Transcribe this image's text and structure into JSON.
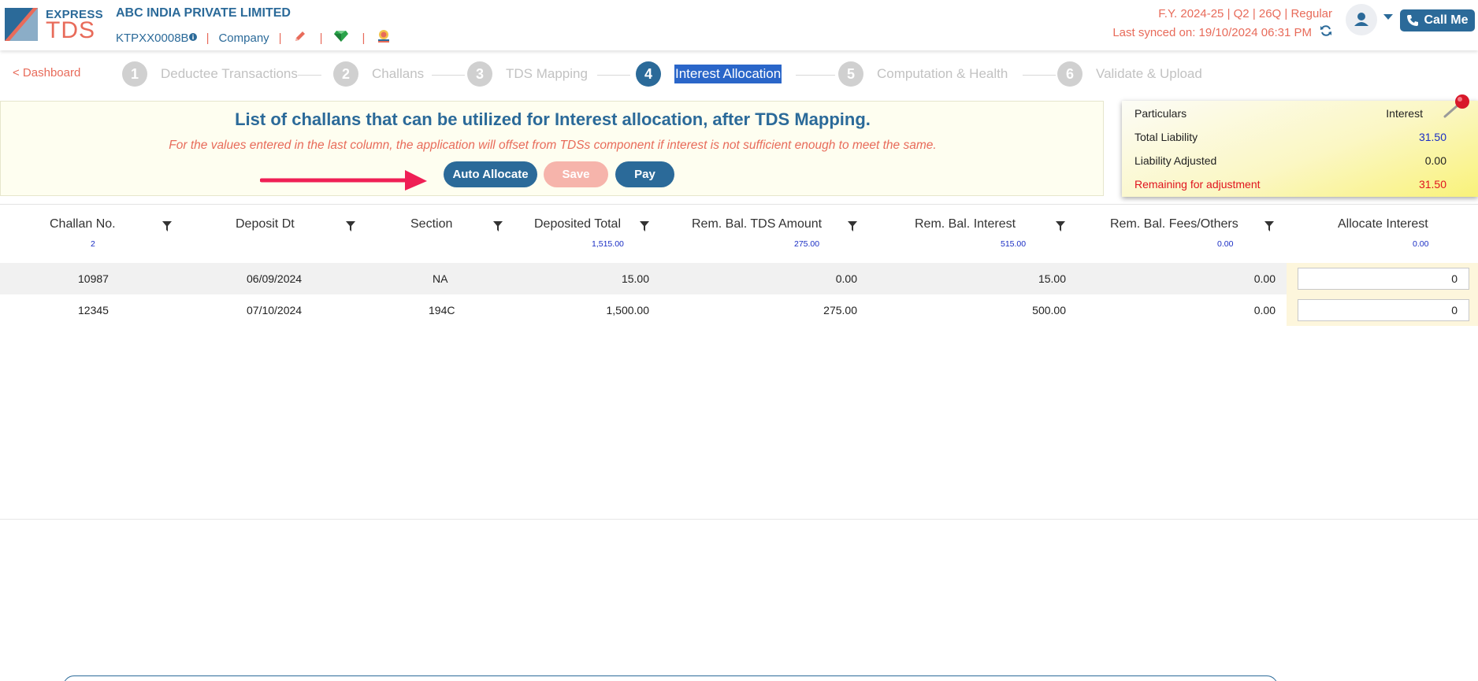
{
  "header": {
    "logo_top": "EXPRESS",
    "logo_bottom": "TDS",
    "company_name": "ABC INDIA PRIVATE LIMITED",
    "tan": "KTPXX0008B",
    "tan_info": "i",
    "company_type": "Company",
    "separator": "|",
    "fy_line": "F.Y. 2024-25  | Q2  | 26Q | Regular",
    "last_synced": "Last synced on: 19/10/2024 06:31 PM",
    "call_me": "Call Me"
  },
  "nav": {
    "dashboard": "< Dashboard",
    "steps": [
      {
        "num": "1",
        "label": "Deductee Transactions"
      },
      {
        "num": "2",
        "label": "Challans"
      },
      {
        "num": "3",
        "label": "TDS Mapping"
      },
      {
        "num": "4",
        "label": "Interest Allocation"
      },
      {
        "num": "5",
        "label": "Computation & Health"
      },
      {
        "num": "6",
        "label": "Validate & Upload"
      }
    ]
  },
  "banner": {
    "title": "List of challans that can be utilized for Interest allocation, after TDS Mapping.",
    "note": "For the values entered in the last column, the application will offset from TDSs component if interest is not sufficient enough to meet the same.",
    "auto_allocate": "Auto Allocate",
    "save": "Save",
    "pay": "Pay"
  },
  "summary": {
    "col1": "Particulars",
    "col2": "Interest",
    "rows": [
      {
        "label": "Total Liability",
        "value": "31.50"
      },
      {
        "label": "Liability Adjusted",
        "value": "0.00"
      },
      {
        "label": "Remaining for adjustment",
        "value": "31.50"
      }
    ]
  },
  "table": {
    "columns": [
      {
        "label": "Challan No.",
        "sub": "2"
      },
      {
        "label": "Deposit Dt",
        "sub": ""
      },
      {
        "label": "Section",
        "sub": ""
      },
      {
        "label": "Deposited Total",
        "sub": "1,515.00"
      },
      {
        "label": "Rem. Bal. TDS Amount",
        "sub": "275.00"
      },
      {
        "label": "Rem. Bal. Interest",
        "sub": "515.00"
      },
      {
        "label": "Rem. Bal. Fees/Others",
        "sub": "0.00"
      },
      {
        "label": "Allocate Interest",
        "sub": "0.00"
      }
    ],
    "rows": [
      {
        "challan": "10987",
        "date": "06/09/2024",
        "section": "NA",
        "deposited": "15.00",
        "tds": "0.00",
        "interest": "15.00",
        "fees": "0.00",
        "allocate": "0"
      },
      {
        "challan": "12345",
        "date": "07/10/2024",
        "section": "194C",
        "deposited": "1,500.00",
        "tds": "275.00",
        "interest": "500.00",
        "fees": "0.00",
        "allocate": "0"
      }
    ]
  },
  "colors": {
    "brand_blue": "#2b6a99",
    "brand_coral": "#e86b5a",
    "highlight_red": "#e0141e",
    "value_blue": "#1a2ec4"
  }
}
